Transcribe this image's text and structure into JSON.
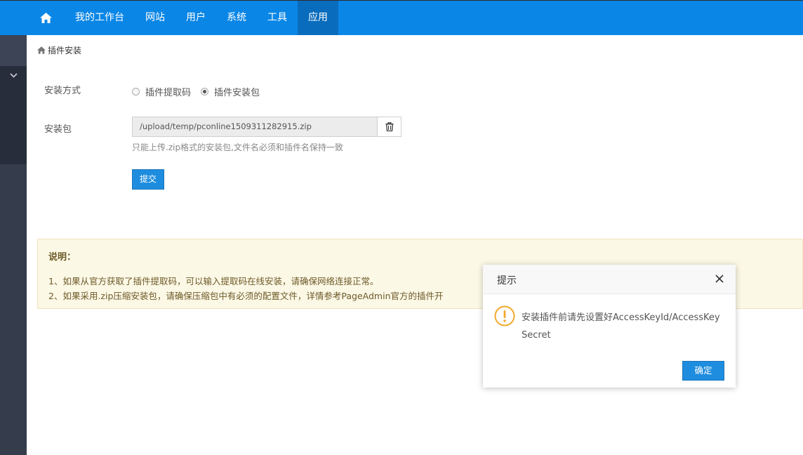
{
  "nav": {
    "home_icon": "home-icon",
    "items": [
      {
        "label": "我的工作台",
        "active": false
      },
      {
        "label": "网站",
        "active": false
      },
      {
        "label": "用户",
        "active": false
      },
      {
        "label": "系统",
        "active": false
      },
      {
        "label": "工具",
        "active": false
      },
      {
        "label": "应用",
        "active": true
      }
    ]
  },
  "sidebar": {
    "toggle_icon": "chevron-down-icon"
  },
  "breadcrumb": {
    "icon": "home-icon",
    "label": "插件安装"
  },
  "form": {
    "install_method_label": "安装方式",
    "options": [
      {
        "label": "插件提取码",
        "checked": false
      },
      {
        "label": "插件安装包",
        "checked": true
      }
    ],
    "package_label": "安装包",
    "package_value": "/upload/temp/pconline1509311282915.zip",
    "delete_icon": "trash-icon",
    "help_text": "只能上传.zip格式的安装包,文件名必须和插件名保持一致",
    "submit_label": "提交"
  },
  "note": {
    "title": "说明：",
    "lines": [
      "1、如果从官方获取了插件提取码，可以输入提取码在线安装，请确保网络连接正常。",
      "2、如果采用.zip压缩安装包，请确保压缩包中有必须的配置文件，详情参考PageAdmin官方的插件开"
    ]
  },
  "dialog": {
    "title": "提示",
    "close_icon": "close-icon",
    "warning_icon": "warning-icon",
    "message": "安装插件前请先设置好AccessKeyId/AccessKeySecret",
    "ok_label": "确定"
  },
  "colors": {
    "nav_bg": "#0a86e6",
    "nav_active": "#0a6cbd",
    "primary_button": "#1e8ddf",
    "sidebar": "#353c4c",
    "note_bg": "#fcf8e6",
    "warning": "#f0a92c"
  }
}
